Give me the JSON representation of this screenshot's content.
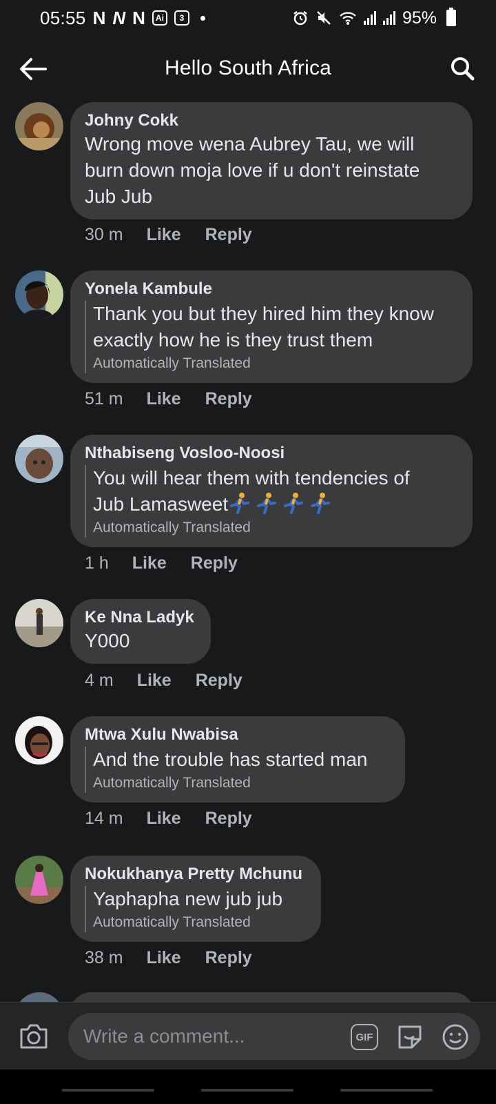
{
  "status_bar": {
    "time": "05:55",
    "battery": "95%",
    "calendar_badge": "3",
    "ai_badge": "Ai"
  },
  "header": {
    "title": "Hello South Africa"
  },
  "comments": [
    {
      "author": "Johny Cokk",
      "text_lines": [
        "Wrong move wena Aubrey Tau, we will",
        "burn down moja love if u don't reinstate",
        "Jub Jub"
      ],
      "translated": false,
      "time": "30 m",
      "like": "Like",
      "reply": "Reply",
      "avatar_color": "#7a4a23"
    },
    {
      "author": "Yonela Kambule",
      "text_lines": [
        "Thank you but they hired him they know",
        "exactly how he is they trust them"
      ],
      "translated": true,
      "translation_note": "Automatically Translated",
      "time": "51 m",
      "like": "Like",
      "reply": "Reply",
      "avatar_color": "#2a2a2a"
    },
    {
      "author": "Nthabiseng Vosloo-Noosi",
      "text_lines": [
        "You will hear them with tendencies of",
        "Jub Lamasweet"
      ],
      "emoji_count": 4,
      "translated": true,
      "translation_note": "Automatically Translated",
      "time": "1 h",
      "like": "Like",
      "reply": "Reply",
      "avatar_color": "#8aa3b5"
    },
    {
      "author": "Ke Nna Ladyk",
      "text_lines": [
        "Y000"
      ],
      "translated": false,
      "time": "4 m",
      "like": "Like",
      "reply": "Reply",
      "avatar_color": "#b7b2a8"
    },
    {
      "author": "Mtwa Xulu Nwabisa",
      "text_lines": [
        "And the trouble has started man"
      ],
      "translated": true,
      "translation_note": "Automatically Translated",
      "time": "14 m",
      "like": "Like",
      "reply": "Reply",
      "avatar_color": "#5a3b2f"
    },
    {
      "author": "Nokukhanya Pretty Mchunu",
      "text_lines": [
        "Yaphapha new jub jub"
      ],
      "translated": true,
      "translation_note": "Automatically Translated",
      "time": "38 m",
      "like": "Like",
      "reply": "Reply",
      "avatar_color": "#4f6b3a"
    }
  ],
  "composer": {
    "placeholder": "Write a comment...",
    "gif_label": "GIF"
  },
  "colors": {
    "background": "#18191a",
    "bubble": "#3a3b3c",
    "text_primary": "#e4e6eb",
    "text_secondary": "#b0b3b8"
  },
  "icons": [
    "back-arrow-icon",
    "search-icon",
    "camera-icon",
    "gif-icon",
    "sticker-icon",
    "emoji-icon",
    "running-man-emoji"
  ]
}
